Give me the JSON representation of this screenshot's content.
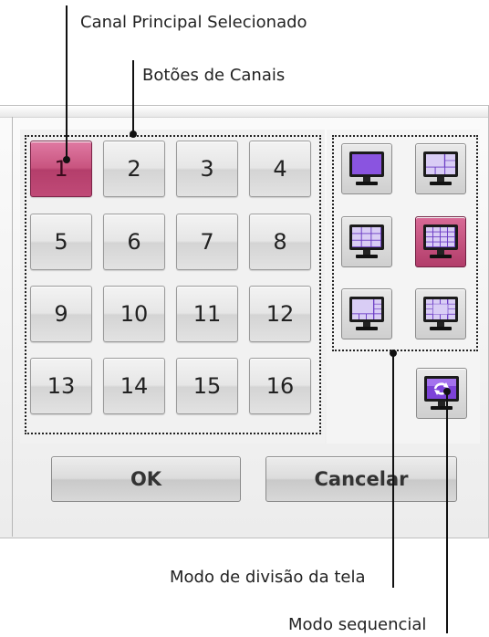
{
  "annotations": {
    "main_channel": "Canal Principal Selecionado",
    "channel_buttons": "Botões de Canais",
    "split_mode": "Modo de divisão da tela",
    "sequential_mode": "Modo sequencial"
  },
  "channels": [
    "1",
    "2",
    "3",
    "4",
    "5",
    "6",
    "7",
    "8",
    "9",
    "10",
    "11",
    "12",
    "13",
    "14",
    "15",
    "16"
  ],
  "selected_channel": "1",
  "split_modes": [
    {
      "name": "split-1-icon",
      "selected": false
    },
    {
      "name": "split-6-icon",
      "selected": false
    },
    {
      "name": "split-9-icon",
      "selected": false
    },
    {
      "name": "split-16-icon",
      "selected": true
    },
    {
      "name": "split-8-icon",
      "selected": false
    },
    {
      "name": "split-13-icon",
      "selected": false
    }
  ],
  "sequential_mode_icon": "sequence-cycle-icon",
  "buttons": {
    "ok": "OK",
    "cancel": "Cancelar"
  },
  "colors": {
    "selected": "#c04a77",
    "screen": "#7a3fd0"
  }
}
